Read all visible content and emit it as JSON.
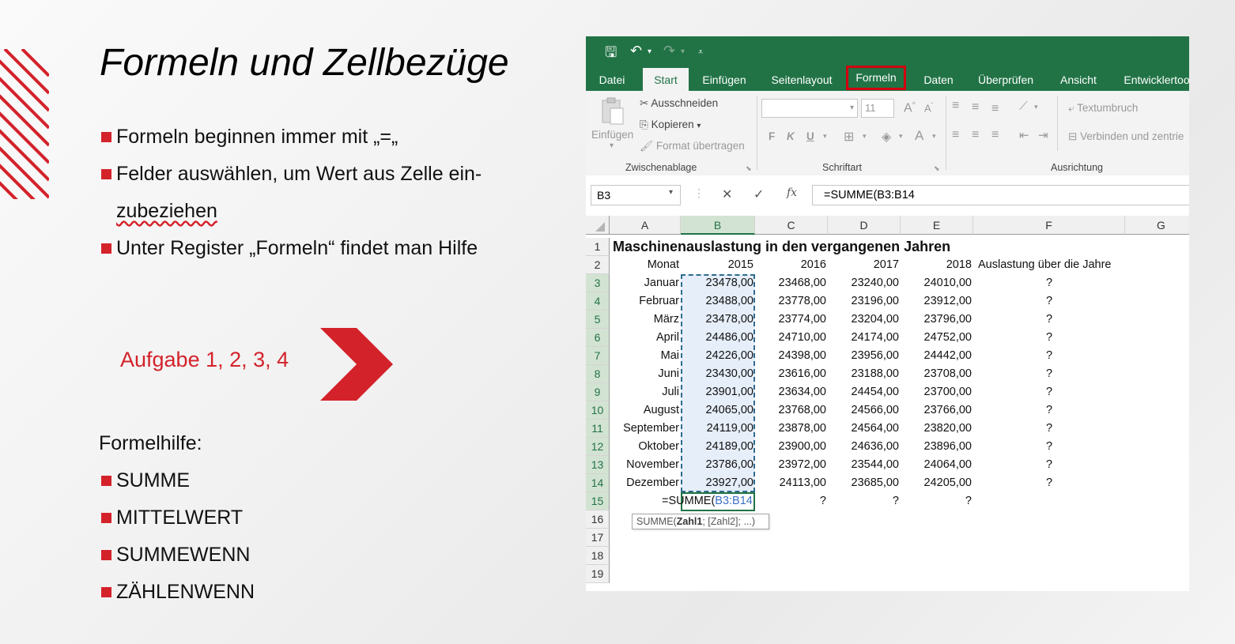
{
  "slide": {
    "title": "Formeln und Zellbezüge",
    "bullets": [
      "Formeln beginnen immer mit „=„",
      "Felder auswählen, um Wert aus Zelle ein-",
      "zubeziehen",
      "Unter Register „Formeln“ findet man Hilfe"
    ],
    "aufgabe": "Aufgabe 1, 2, 3, 4",
    "formelhilfe_heading": "Formelhilfe:",
    "formelhilfe_items": [
      "SUMME",
      "MITTELWERT",
      "SUMMEWENN",
      "ZÄHLENWENN"
    ],
    "accent_color": "#d4222a"
  },
  "excel": {
    "theme_color": "#217346",
    "tabs": [
      "Datei",
      "Start",
      "Einfügen",
      "Seitenlayout",
      "Formeln",
      "Daten",
      "Überprüfen",
      "Ansicht",
      "Entwicklertoo"
    ],
    "active_tab": "Start",
    "highlighted_tab": "Formeln",
    "ribbon": {
      "clipboard": {
        "paste": "Einfügen",
        "cut": "Ausschneiden",
        "copy": "Kopieren",
        "format_painter": "Format übertragen",
        "group": "Zwischenablage"
      },
      "font": {
        "size": "11",
        "bold": "F",
        "italic": "K",
        "underline": "U",
        "group": "Schriftart"
      },
      "alignment": {
        "wrap": "Textumbruch",
        "merge": "Verbinden und zentrie",
        "group": "Ausrichtung"
      }
    },
    "name_box": "B3",
    "formula": "=SUMME(B3:B14",
    "fx": "fx",
    "columns": [
      "A",
      "B",
      "C",
      "D",
      "E",
      "F",
      "G"
    ],
    "rows": [
      "1",
      "2",
      "3",
      "4",
      "5",
      "6",
      "7",
      "8",
      "9",
      "10",
      "11",
      "12",
      "13",
      "14",
      "15",
      "16",
      "17",
      "18",
      "19"
    ],
    "sheet": {
      "title": "Maschinenauslastung in den vergangenen Jahren",
      "header": [
        "Monat",
        "2015",
        "2016",
        "2017",
        "2018",
        "Auslastung über die Jahre"
      ],
      "data": [
        [
          "Januar",
          "23478,00",
          "23468,00",
          "23240,00",
          "24010,00",
          "?"
        ],
        [
          "Februar",
          "23488,00",
          "23778,00",
          "23196,00",
          "23912,00",
          "?"
        ],
        [
          "März",
          "23478,00",
          "23774,00",
          "23204,00",
          "23796,00",
          "?"
        ],
        [
          "April",
          "24486,00",
          "24710,00",
          "24174,00",
          "24752,00",
          "?"
        ],
        [
          "Mai",
          "24226,00",
          "24398,00",
          "23956,00",
          "24442,00",
          "?"
        ],
        [
          "Juni",
          "23430,00",
          "23616,00",
          "23188,00",
          "23708,00",
          "?"
        ],
        [
          "Juli",
          "23901,00",
          "23634,00",
          "24454,00",
          "23700,00",
          "?"
        ],
        [
          "August",
          "24065,00",
          "23768,00",
          "24566,00",
          "23766,00",
          "?"
        ],
        [
          "September",
          "24119,00",
          "23878,00",
          "24564,00",
          "23820,00",
          "?"
        ],
        [
          "Oktober",
          "24189,00",
          "23900,00",
          "24636,00",
          "23896,00",
          "?"
        ],
        [
          "November",
          "23786,00",
          "23972,00",
          "23544,00",
          "24064,00",
          "?"
        ],
        [
          "Dezember",
          "23927,00",
          "24113,00",
          "23685,00",
          "24205,00",
          "?"
        ]
      ],
      "row15": {
        "formula_prefix": "=SUMME(",
        "formula_ref": "B3:B14",
        "c": "?",
        "d": "?",
        "e": "?"
      },
      "tooltip": {
        "fn": "SUMME(",
        "arg1": "Zahl1",
        "rest": "; [Zahl2]; ...)"
      }
    }
  }
}
